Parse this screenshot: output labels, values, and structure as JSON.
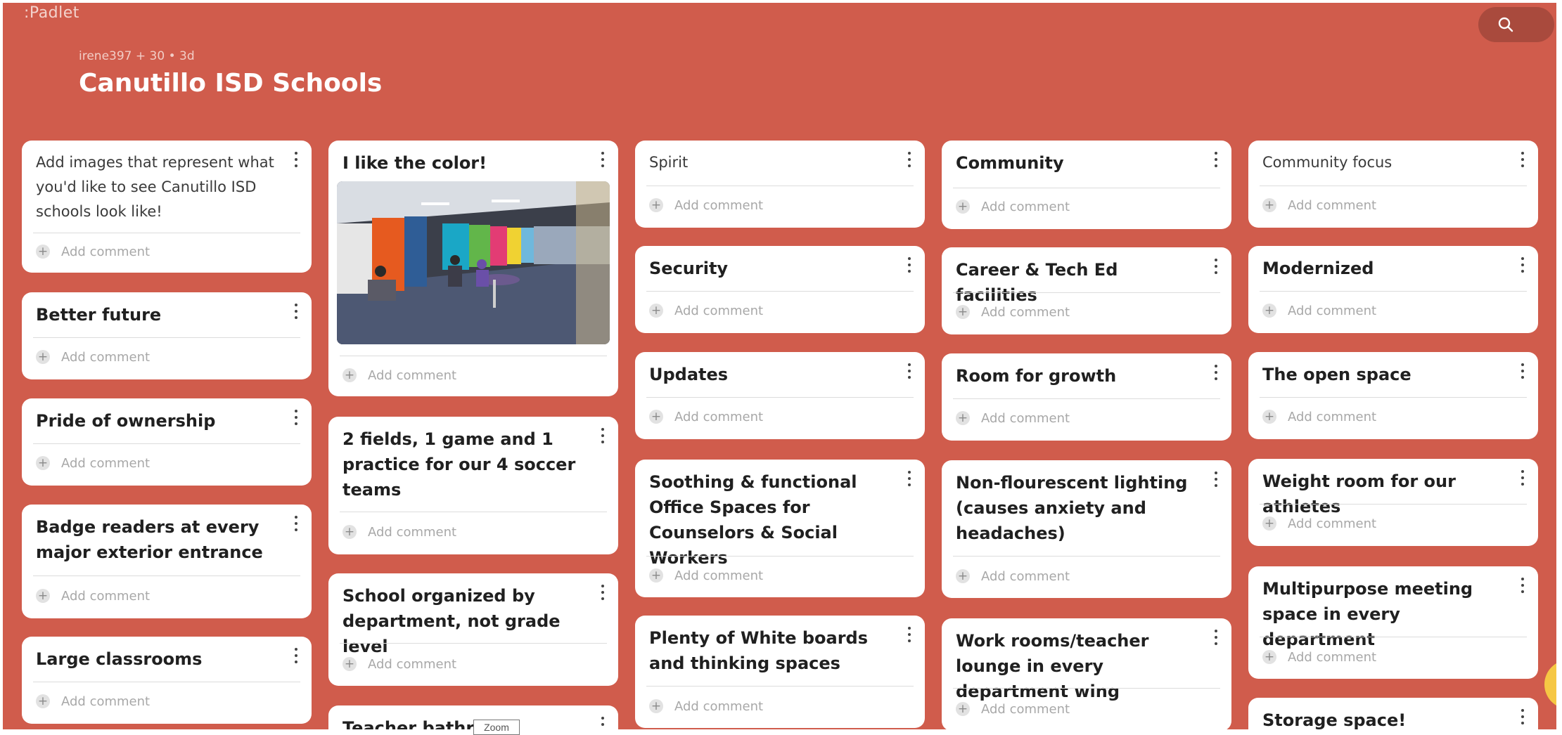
{
  "app": {
    "brand": "Padlet"
  },
  "board": {
    "meta": "irene397 + 30 •  3d",
    "title": "Canutillo ISD Schools",
    "background": "#d05c4c"
  },
  "comment_label": "Add comment",
  "tooltip": "Zoom",
  "columns": [
    [
      {
        "text": "Add images that represent what you'd like to see Canutillo ISD schools look like!",
        "style": "plain"
      },
      {
        "text": "Better future",
        "style": "bold"
      },
      {
        "text": "Pride of ownership",
        "style": "bold"
      },
      {
        "text": "Badge readers at every major exterior entrance",
        "style": "bold"
      },
      {
        "text": "Large classrooms",
        "style": "bold"
      }
    ],
    [
      {
        "text": "I like the color!",
        "style": "bold",
        "has_image": true
      },
      {
        "text": "2 fields, 1 game and 1 practice for our 4 soccer teams",
        "style": "bold"
      },
      {
        "text": "School organized by department, not grade level",
        "style": "bold"
      },
      {
        "text": "Teacher bathro",
        "style": "bold"
      }
    ],
    [
      {
        "text": "Spirit",
        "style": "plain"
      },
      {
        "text": "Security",
        "style": "bold"
      },
      {
        "text": "Updates",
        "style": "bold"
      },
      {
        "text": "Soothing & functional Office Spaces for Counselors & Social Workers",
        "style": "bold"
      },
      {
        "text": "Plenty of White boards and thinking spaces",
        "style": "bold"
      }
    ],
    [
      {
        "text": "Community",
        "style": "bold"
      },
      {
        "text": "Career & Tech Ed facilities",
        "style": "bold"
      },
      {
        "text": "Room for growth",
        "style": "bold"
      },
      {
        "text": "Non-flourescent lighting (causes anxiety and headaches)",
        "style": "bold"
      },
      {
        "text": "Work rooms/teacher lounge in every department wing",
        "style": "bold"
      }
    ],
    [
      {
        "text": "Community focus",
        "style": "plain"
      },
      {
        "text": "Modernized",
        "style": "bold"
      },
      {
        "text": "The open space",
        "style": "bold"
      },
      {
        "text": "Weight room for our athletes",
        "style": "bold"
      },
      {
        "text": "Multipurpose meeting space in every department",
        "style": "bold"
      },
      {
        "text": "Storage space!",
        "style": "bold"
      }
    ]
  ]
}
